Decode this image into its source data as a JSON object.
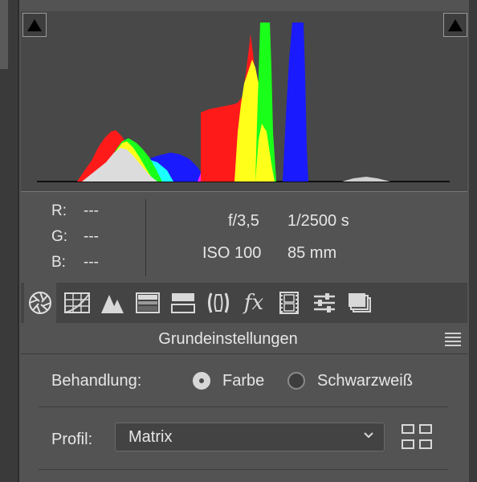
{
  "histogram": {
    "clip_left_icon": "shadow-clipping-triangle-icon",
    "clip_right_icon": "highlight-clipping-triangle-icon",
    "colors": {
      "red": "#ff1a1a",
      "yellow": "#ffff1a",
      "green": "#1aff1a",
      "cyan": "#1affff",
      "blue": "#1a1aff",
      "magenta": "#ff1aff",
      "white": "#dcdcdc"
    }
  },
  "readout": {
    "r_label": "R:",
    "r_value": "---",
    "g_label": "G:",
    "g_value": "---",
    "b_label": "B:",
    "b_value": "---"
  },
  "exif": {
    "aperture": "f/3,5",
    "shutter": "1/2500 s",
    "iso": "ISO 100",
    "focal": "85 mm"
  },
  "tabs": [
    {
      "icon": "aperture-icon",
      "active": true
    },
    {
      "icon": "tone-curve-grid-icon"
    },
    {
      "icon": "detail-triangles-icon"
    },
    {
      "icon": "hsl-gradient-icon"
    },
    {
      "icon": "split-toning-icon"
    },
    {
      "icon": "lens-corrections-icon"
    },
    {
      "icon": "fx-effects-icon"
    },
    {
      "icon": "camera-calibration-film-icon"
    },
    {
      "icon": "sliders-presets-icon"
    },
    {
      "icon": "snapshots-icon"
    }
  ],
  "section": {
    "title": "Grundeinstellungen",
    "menu_icon": "panel-menu-icon"
  },
  "treatment": {
    "label": "Behandlung:",
    "option_color": "Farbe",
    "option_bw": "Schwarzweiß",
    "selected": "Farbe"
  },
  "profile": {
    "label": "Profil:",
    "value": "Matrix",
    "browser_icon": "profile-browser-grid-icon"
  }
}
